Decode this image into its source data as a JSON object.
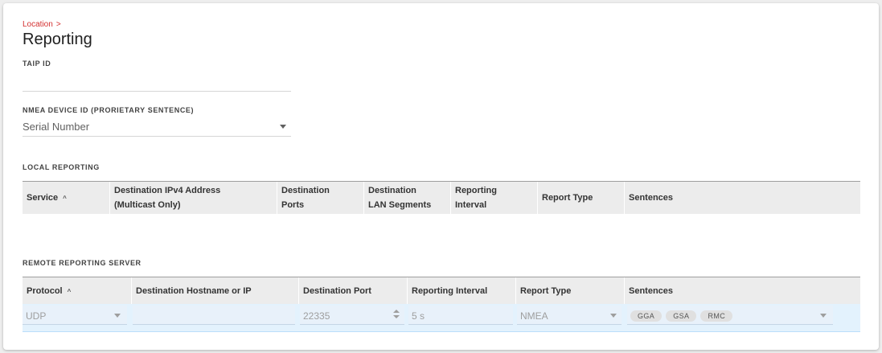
{
  "breadcrumb": {
    "label": "Location",
    "chevron": ">"
  },
  "page": {
    "title": "Reporting"
  },
  "taip": {
    "label": "TAIP ID",
    "value": ""
  },
  "nmea": {
    "label": "NMEA DEVICE ID (PRORIETARY SENTENCE)",
    "value": "Serial Number"
  },
  "local": {
    "title": "LOCAL REPORTING",
    "columns": [
      {
        "line1": "Service",
        "line2": ""
      },
      {
        "line1": "Destination IPv4 Address",
        "line2": "(Multicast Only)"
      },
      {
        "line1": "Destination",
        "line2": "Ports"
      },
      {
        "line1": "Destination",
        "line2": "LAN Segments"
      },
      {
        "line1": "Reporting",
        "line2": "Interval"
      },
      {
        "line1": "Report Type",
        "line2": ""
      },
      {
        "line1": "Sentences",
        "line2": ""
      }
    ]
  },
  "remote": {
    "title": "REMOTE REPORTING SERVER",
    "columns": [
      "Protocol",
      "Destination Hostname or IP",
      "Destination Port",
      "Reporting Interval",
      "Report Type",
      "Sentences"
    ],
    "row": {
      "protocol": "UDP",
      "hostname": "",
      "port": "22335",
      "interval": "5 s",
      "report_type": "NMEA",
      "sentences": [
        "GGA",
        "GSA",
        "RMC"
      ]
    }
  },
  "colors": {
    "accent": "#d32f2f",
    "row_highlight": "#e3f2fd"
  },
  "icons": {
    "sort": "sort-asc-icon",
    "dropdown": "caret-down-icon"
  }
}
